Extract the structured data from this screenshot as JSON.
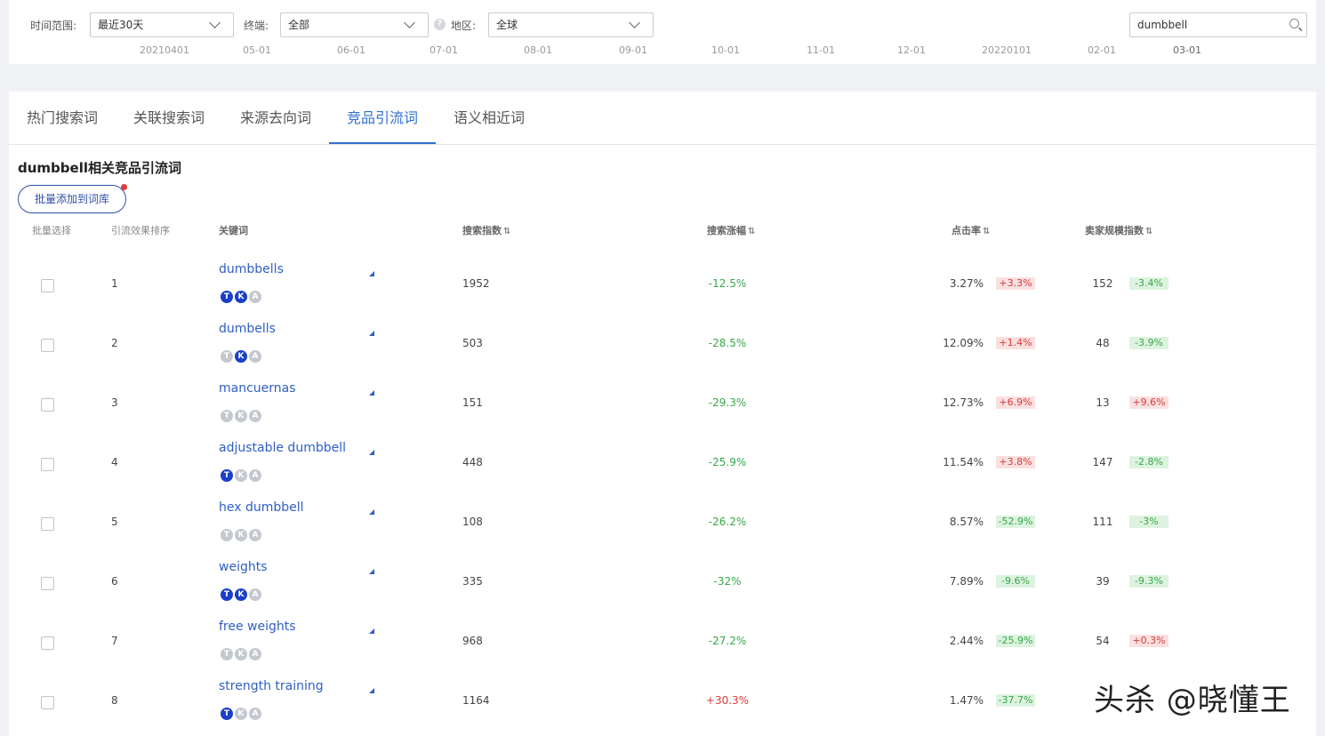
{
  "filters": {
    "time_label": "时间范围:",
    "time_value": "最近30天",
    "device_label": "终端:",
    "device_value": "全部",
    "region_label": "地区:",
    "region_value": "全球",
    "search_value": "dumbbell"
  },
  "date_axis": [
    "20210401",
    "05-01",
    "06-01",
    "07-01",
    "08-01",
    "09-01",
    "10-01",
    "11-01",
    "12-01",
    "20220101",
    "02-01",
    "03-01"
  ],
  "tabs": [
    "热门搜索词",
    "关联搜索词",
    "来源去向词",
    "竞品引流词",
    "语义相近词"
  ],
  "active_tab": 3,
  "section_title": "dumbbell相关竞品引流词",
  "bulk_button": "批量添加到词库",
  "columns": {
    "select": "批量选择",
    "rank": "引流效果排序",
    "keyword": "关键词",
    "search_index": "搜索指数",
    "search_growth": "搜索涨幅",
    "ctr": "点击率",
    "seller_index": "卖家规模指数"
  },
  "badge_letters": [
    "T",
    "K",
    "A"
  ],
  "rows": [
    {
      "rank": "1",
      "keyword": "dumbbells",
      "badges": [
        true,
        true,
        false
      ],
      "search_index": "1952",
      "search_growth": "-12.5%",
      "ctr": "3.27%",
      "ctr_change": "+3.3%",
      "seller_index": "152",
      "seller_change": "-3.4%"
    },
    {
      "rank": "2",
      "keyword": "dumbells",
      "badges": [
        false,
        true,
        false
      ],
      "search_index": "503",
      "search_growth": "-28.5%",
      "ctr": "12.09%",
      "ctr_change": "+1.4%",
      "seller_index": "48",
      "seller_change": "-3.9%"
    },
    {
      "rank": "3",
      "keyword": "mancuernas",
      "badges": [
        false,
        false,
        false
      ],
      "search_index": "151",
      "search_growth": "-29.3%",
      "ctr": "12.73%",
      "ctr_change": "+6.9%",
      "seller_index": "13",
      "seller_change": "+9.6%"
    },
    {
      "rank": "4",
      "keyword": "adjustable dumbbell",
      "badges": [
        true,
        false,
        false
      ],
      "search_index": "448",
      "search_growth": "-25.9%",
      "ctr": "11.54%",
      "ctr_change": "+3.8%",
      "seller_index": "147",
      "seller_change": "-2.8%"
    },
    {
      "rank": "5",
      "keyword": "hex dumbbell",
      "badges": [
        false,
        false,
        false
      ],
      "search_index": "108",
      "search_growth": "-26.2%",
      "ctr": "8.57%",
      "ctr_change": "-52.9%",
      "seller_index": "111",
      "seller_change": "-3%"
    },
    {
      "rank": "6",
      "keyword": "weights",
      "badges": [
        true,
        true,
        false
      ],
      "search_index": "335",
      "search_growth": "-32%",
      "ctr": "7.89%",
      "ctr_change": "-9.6%",
      "seller_index": "39",
      "seller_change": "-9.3%"
    },
    {
      "rank": "7",
      "keyword": "free weights",
      "badges": [
        false,
        false,
        false
      ],
      "search_index": "968",
      "search_growth": "-27.2%",
      "ctr": "2.44%",
      "ctr_change": "-25.9%",
      "seller_index": "54",
      "seller_change": "+0.3%"
    },
    {
      "rank": "8",
      "keyword": "strength training",
      "badges": [
        true,
        false,
        false
      ],
      "search_index": "1164",
      "search_growth": "+30.3%",
      "ctr": "1.47%",
      "ctr_change": "-37.7%",
      "seller_index": "",
      "seller_change": ""
    }
  ],
  "watermark": "头杀 @晓懂王",
  "colors": {
    "accent": "#2f6fd0",
    "keyword": "#2f5fc4",
    "badge_on": "#1a3fc8",
    "positive": "#d83a3a",
    "negative": "#37a84a"
  }
}
